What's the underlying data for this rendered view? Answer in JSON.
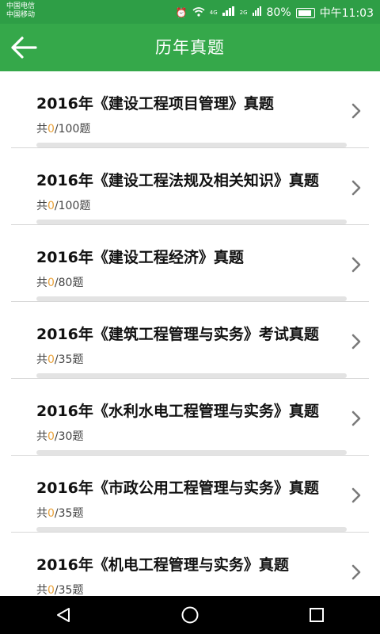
{
  "status_bar": {
    "carrier1": "中国电信",
    "carrier2": "中国移动",
    "icons": [
      "alarm-icon",
      "wifi-icon",
      "signal-icon",
      "battery-icon"
    ],
    "network1": "4G",
    "network2": "2G",
    "battery": "80%",
    "time": "中午11:03"
  },
  "header": {
    "title": "历年真题",
    "back_icon": "arrow-left-icon",
    "color": "#35a84a"
  },
  "items": [
    {
      "title": "2016年《建设工程项目管理》真题",
      "prefix": "共",
      "done": "0",
      "total": "/100题"
    },
    {
      "title": "2016年《建设工程法规及相关知识》真题",
      "prefix": "共",
      "done": "0",
      "total": "/100题"
    },
    {
      "title": "2016年《建设工程经济》真题",
      "prefix": "共",
      "done": "0",
      "total": "/80题"
    },
    {
      "title": "2016年《建筑工程管理与实务》考试真题",
      "prefix": "共",
      "done": "0",
      "total": "/35题"
    },
    {
      "title": "2016年《水利水电工程管理与实务》真题",
      "prefix": "共",
      "done": "0",
      "total": "/30题"
    },
    {
      "title": "2016年《市政公用工程管理与实务》真题",
      "prefix": "共",
      "done": "0",
      "total": "/35题"
    },
    {
      "title": "2016年《机电工程管理与实务》真题",
      "prefix": "共",
      "done": "0",
      "total": "/35题"
    }
  ],
  "progress_fraction": 0,
  "nav": [
    "back-triangle-icon",
    "home-circle-icon",
    "recents-square-icon"
  ]
}
